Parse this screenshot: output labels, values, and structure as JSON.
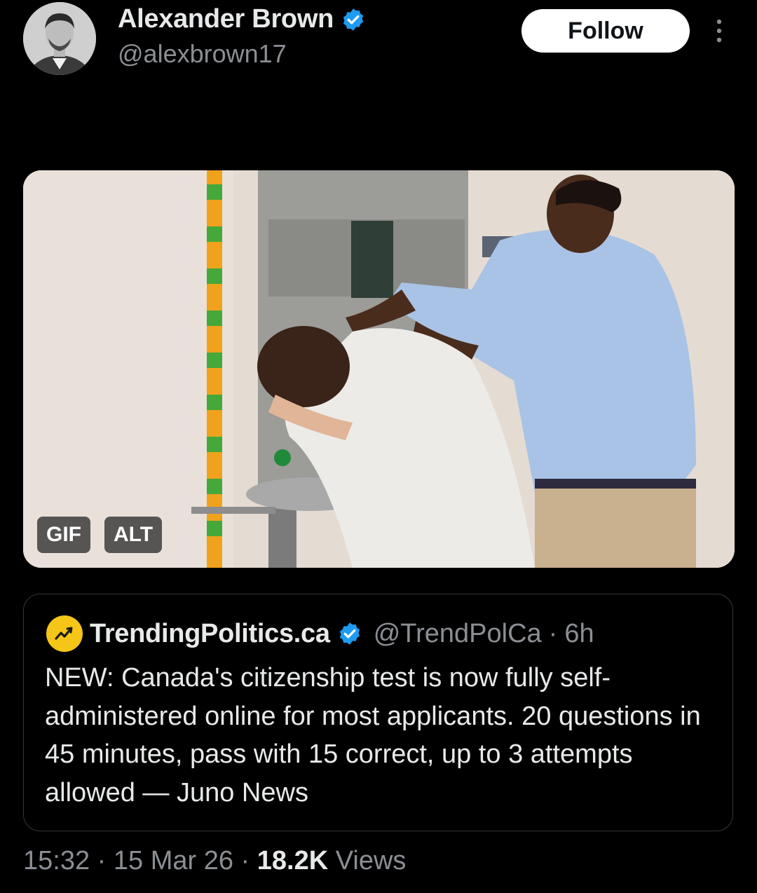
{
  "author": {
    "name": "Alexander Brown",
    "handle": "@alexbrown17",
    "verified": true,
    "avatar_icon": "person-avatar"
  },
  "actions": {
    "follow_label": "Follow",
    "more_icon": "more-vertical-icon"
  },
  "media": {
    "type": "gif",
    "gif_badge": "GIF",
    "alt_badge": "ALT"
  },
  "quoted": {
    "name": "TrendingPolitics.ca",
    "handle": "@TrendPolCa",
    "separator": "·",
    "time": "6h",
    "verified": true,
    "text": "NEW: Canada's citizenship test is now fully self-administered online for most applicants. 20 questions in 45 minutes, pass with 15 correct, up to 3 attempts allowed — Juno News"
  },
  "meta": {
    "time": "15:32",
    "date": "15 Mar 26",
    "separator": "·",
    "views_count": "18.2K",
    "views_label": "Views"
  },
  "colors": {
    "background": "#000000",
    "verified_blue": "#1d9bf0",
    "muted_text": "#8b8f94",
    "logo_yellow": "#f5c518"
  }
}
